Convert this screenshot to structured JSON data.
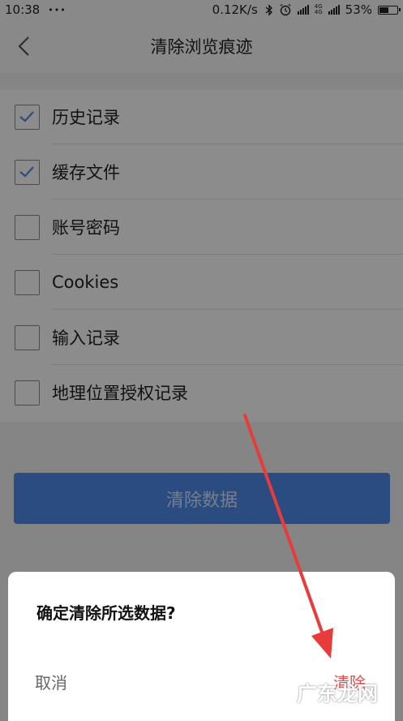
{
  "status_bar": {
    "time": "10:38",
    "dots": "•••",
    "net_speed": "0.12K/s",
    "net_tag_top": "4G",
    "net_tag_bottom": "4G",
    "battery": "53%",
    "battery_level": 0.53
  },
  "nav": {
    "title": "清除浏览痕迹"
  },
  "options": [
    {
      "label": "历史记录",
      "checked": true
    },
    {
      "label": "缓存文件",
      "checked": true
    },
    {
      "label": "账号密码",
      "checked": false
    },
    {
      "label": "Cookies",
      "checked": false
    },
    {
      "label": "输入记录",
      "checked": false
    },
    {
      "label": "地理位置授权记录",
      "checked": false
    }
  ],
  "clear_button": "清除数据",
  "dialog": {
    "question": "确定清除所选数据?",
    "cancel": "取消",
    "confirm": "清除"
  },
  "watermark": "广东龙网",
  "colors": {
    "accent": "#4e8bea",
    "danger": "#e74c4c",
    "annotation": "#e83b3b"
  }
}
